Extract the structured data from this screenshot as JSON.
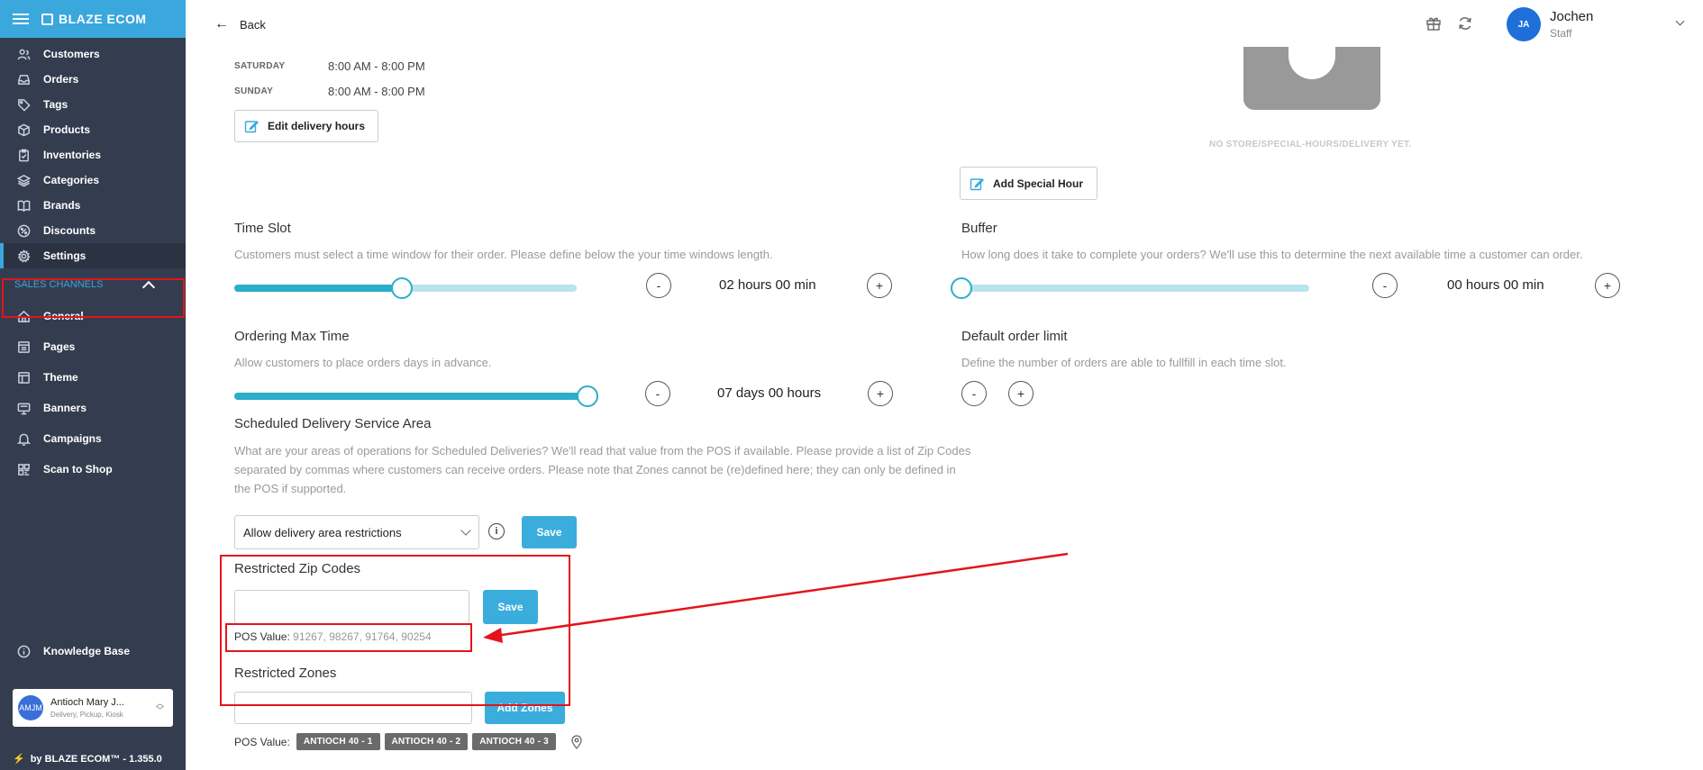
{
  "app": {
    "brand": "BLAZE ECOM"
  },
  "sidebar": {
    "items": [
      {
        "label": "Customers",
        "icon": "customers-icon"
      },
      {
        "label": "Orders",
        "icon": "orders-icon"
      },
      {
        "label": "Tags",
        "icon": "tag-icon"
      },
      {
        "label": "Products",
        "icon": "box-icon"
      },
      {
        "label": "Inventories",
        "icon": "clipboard-icon"
      },
      {
        "label": "Categories",
        "icon": "layers-icon"
      },
      {
        "label": "Brands",
        "icon": "book-icon"
      },
      {
        "label": "Discounts",
        "icon": "discount-icon"
      },
      {
        "label": "Settings",
        "icon": "gear-icon"
      }
    ],
    "sales_channels_label": "SALES CHANNELS",
    "channels": [
      {
        "label": "General",
        "icon": "home-icon"
      },
      {
        "label": "Pages",
        "icon": "pages-icon"
      },
      {
        "label": "Theme",
        "icon": "theme-icon"
      },
      {
        "label": "Banners",
        "icon": "banner-icon"
      },
      {
        "label": "Campaigns",
        "icon": "bell-icon"
      },
      {
        "label": "Scan to Shop",
        "icon": "qr-icon"
      }
    ],
    "knowledge_base": "Knowledge Base",
    "store": {
      "initials": "AMJM",
      "name": "Antioch Mary J...",
      "sub": "Delivery, Pickup, Kiosk"
    },
    "footer": "by BLAZE ECOM™ - 1.355.0"
  },
  "topbar": {
    "back_label": "Back",
    "user": {
      "initials": "JA",
      "name": "Jochen",
      "role": "Staff"
    }
  },
  "hours": [
    {
      "day": "SATURDAY",
      "time": "8:00 AM - 8:00 PM"
    },
    {
      "day": "SUNDAY",
      "time": "8:00 AM - 8:00 PM"
    }
  ],
  "edit_delivery_hours": "Edit delivery hours",
  "no_store_text": "NO STORE/SPECIAL-HOURS/DELIVERY YET.",
  "add_special_hour": "Add Special Hour",
  "time_slot": {
    "title": "Time Slot",
    "desc": "Customers must select a time window for their order. Please define below the your time windows length.",
    "value": "02 hours 00 min",
    "slider_fraction": 0.49
  },
  "buffer": {
    "title": "Buffer",
    "desc": "How long does it take to complete your orders? We'll use this to determine the next available time a customer can order.",
    "value": "00 hours 00 min",
    "slider_fraction": 0.0
  },
  "ordering_max": {
    "title": "Ordering Max Time",
    "desc": "Allow customers to place orders days in advance.",
    "value": "07 days 00 hours",
    "slider_fraction": 1.0
  },
  "order_limit": {
    "title": "Default order limit",
    "desc": "Define the number of orders are able to fullfill in each time slot."
  },
  "service_area": {
    "title": "Scheduled Delivery Service Area",
    "desc": "What are your areas of operations for Scheduled Deliveries? We'll read that value from the POS if available. Please provide a list of Zip Codes separated by commas where customers can receive orders. Please note that Zones cannot be (re)defined here; they can only be defined in the POS if supported.",
    "select_value": "Allow delivery area restrictions",
    "save": "Save"
  },
  "zip": {
    "title": "Restricted Zip Codes",
    "save": "Save",
    "pos_label": "POS Value:",
    "pos_value": "91267, 98267, 91764, 90254"
  },
  "zones": {
    "title": "Restricted Zones",
    "add": "Add Zones",
    "pos_label": "POS Value:",
    "chips": [
      "ANTIOCH 40 - 1",
      "ANTIOCH 40 - 2",
      "ANTIOCH 40 - 3"
    ]
  },
  "colors": {
    "accent": "#3aa7dd",
    "sidebar": "#343d4f",
    "highlight": "#e3141c",
    "slider": "#2aaecb"
  }
}
